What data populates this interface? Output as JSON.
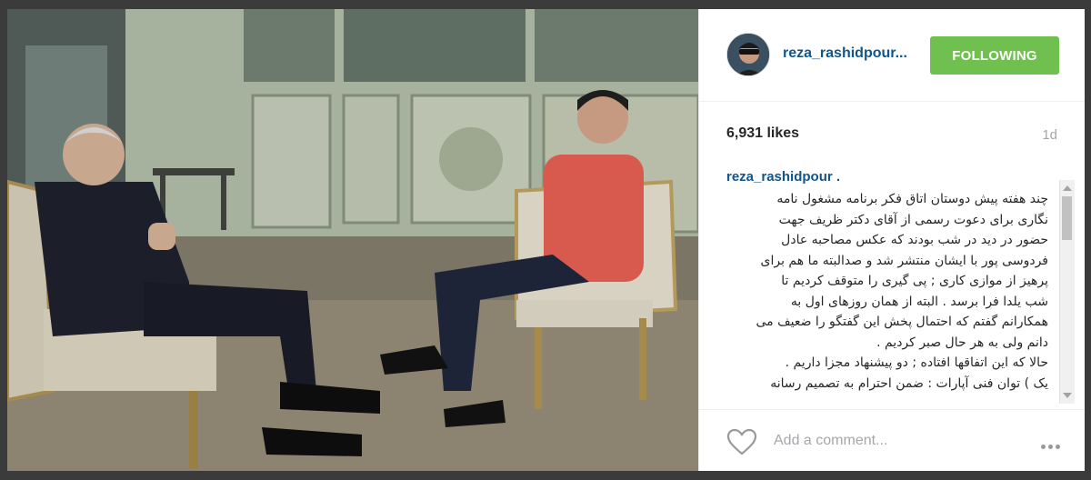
{
  "post": {
    "photo_icon": "interview-photo"
  },
  "header": {
    "avatar_icon": "user-avatar",
    "username": "reza_rashidpour...",
    "follow_label": "FOLLOWING"
  },
  "stats": {
    "likes": "6,931 likes",
    "age": "1d"
  },
  "caption": {
    "author": "reza_rashidpour .",
    "lines": [
      "چند هفته پیش دوستان اتاق فکر برنامه مشغول نامه",
      "نگاری برای دعوت رسمی از آقای دکتر ظریف جهت",
      "حضور در دید در شب بودند که عکس مصاحبه عادل",
      "فردوسی پور با ایشان منتشر شد و صدالبته ما هم برای",
      "پرهیز از موازی کاری ; پی گیری را متوقف کردیم تا",
      "شب یلدا فرا برسد . البته از همان روزهای اول به",
      "همکارانم گفتم که احتمال پخش این گفتگو را ضعیف می",
      "دانم ولی به هر حال صبر کردیم .",
      "حالا که این اتفاقها افتاده ; دو پیشنهاد مجزا داریم .",
      "یک ) توان فنی آپارات : ضمن احترام به تصمیم رسانه"
    ]
  },
  "footer": {
    "like_icon": "heart-icon",
    "comment_placeholder": "Add a comment...",
    "more_icon": "more-options-icon"
  },
  "colors": {
    "username": "#125688",
    "follow_button": "#70c050",
    "muted": "#a5a7aa"
  }
}
